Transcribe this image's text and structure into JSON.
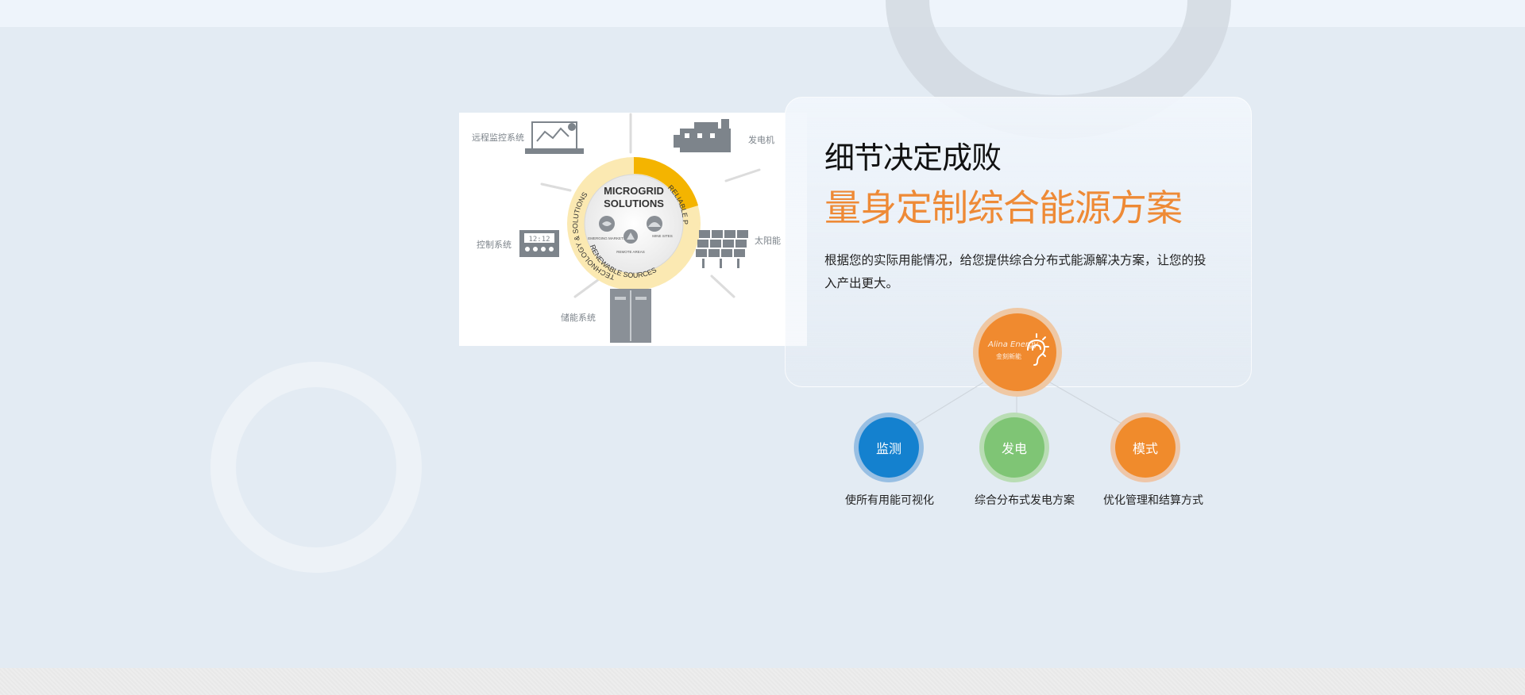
{
  "section": {
    "title": "细节决定成败",
    "subtitle": "量身定制综合能源方案",
    "description": "根据您的实际用能情况，给您提供综合分布式能源解决方案，让您的投入产出更大。"
  },
  "diagram": {
    "center_line1": "MICROGRID",
    "center_line2": "SOLUTIONS",
    "ring_reliable": "RELIABLE POWER",
    "ring_renewable": "RENEWABLE SOURCES",
    "ring_technology": "TECHNOLOGY & SOLUTIONS",
    "inner_emerging": "EMERGING MARKETS",
    "inner_mine": "MINE SITES",
    "inner_remote": "REMOTE AREAS",
    "label_remote_monitor": "远程监控系统",
    "label_generator": "发电机",
    "label_control": "控制系统",
    "label_solar": "太阳能",
    "label_storage": "储能系统",
    "clock": "12:12"
  },
  "hub": {
    "script_text": "Alina Energy",
    "sub_text": "金刻新能"
  },
  "features": [
    {
      "label": "监测",
      "caption": "使所有用能可视化"
    },
    {
      "label": "发电",
      "caption": "综合分布式发电方案"
    },
    {
      "label": "模式",
      "caption": "优化管理和结算方式"
    }
  ],
  "colors": {
    "accent_orange": "#f08a2f",
    "blue": "#1481cf",
    "green": "#7fc575",
    "ring_yellow": "#f5c443"
  },
  "icons": [
    "laptop-chart-icon",
    "generator-icon",
    "control-panel-icon",
    "solar-panel-icon",
    "storage-cabinet-icon",
    "listening-ear-icon"
  ]
}
